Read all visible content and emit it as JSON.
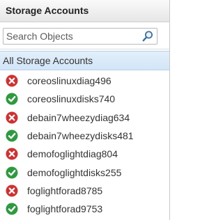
{
  "panel": {
    "title": "Storage Accounts",
    "search": {
      "placeholder": "Search Objects",
      "value": ""
    },
    "all_item_label": "All Storage Accounts",
    "items": [
      {
        "label": "coreoslinuxdiag496",
        "status": "error"
      },
      {
        "label": "coreoslinuxdisks740",
        "status": "ok"
      },
      {
        "label": "debain7wheezydiag634",
        "status": "error"
      },
      {
        "label": "debain7wheezydisks481",
        "status": "ok"
      },
      {
        "label": "demofoglightdiag804",
        "status": "error"
      },
      {
        "label": "demofoglightdisks255",
        "status": "ok"
      },
      {
        "label": "foglightforad8785",
        "status": "error"
      },
      {
        "label": "foglightforad9753",
        "status": "ok"
      }
    ]
  },
  "colors": {
    "error": "#d32f2f",
    "ok": "#2e9a3e",
    "selection": "#d9e9f8"
  }
}
